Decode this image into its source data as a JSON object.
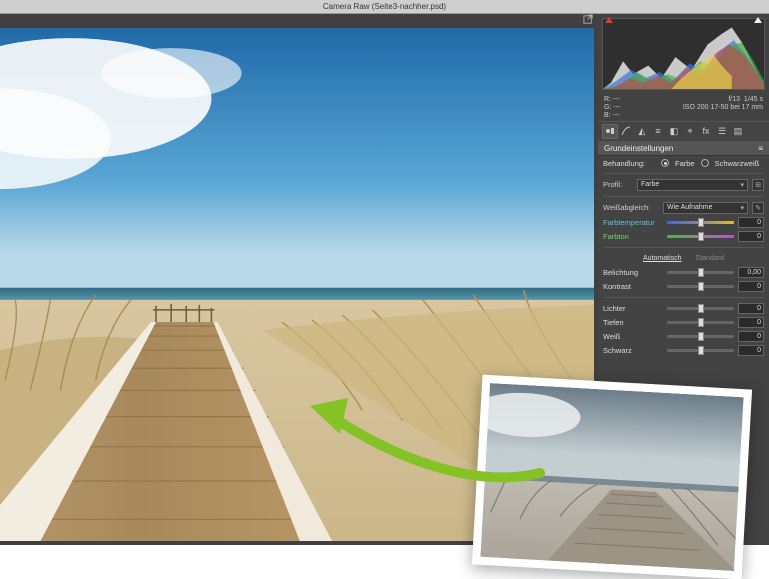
{
  "titlebar": {
    "title": "Camera Raw (Seite3-nachher.psd)"
  },
  "meta": {
    "r": "R:   ---",
    "g": "G:   ---",
    "b": "B:   ---",
    "aperture": "f/13",
    "shutter": "1/45 s",
    "iso_lens": "ISO 200   17-50 bei 17 mm"
  },
  "panel": {
    "header": "Grundeinstellungen",
    "treatment_label": "Behandlung:",
    "treatment_color": "Farbe",
    "treatment_bw": "Schwarzweiß",
    "profile_label": "Profil:",
    "profile_value": "Farbe",
    "wb_label": "Weißabgleich:",
    "wb_value": "Wie Aufnahme",
    "temp_label": "Farbtemperatur",
    "tint_label": "Farbton",
    "auto_link": "Automatisch",
    "default_link": "Standard",
    "sliders": {
      "exposure": {
        "label": "Belichtung",
        "value": "0,00"
      },
      "contrast": {
        "label": "Kontrast",
        "value": "0"
      },
      "highlights": {
        "label": "Lichter",
        "value": "0"
      },
      "shadows": {
        "label": "Tiefen",
        "value": "0"
      },
      "whites": {
        "label": "Weiß",
        "value": "0"
      },
      "blacks": {
        "label": "Schwarz",
        "value": "0"
      }
    },
    "zero": "0"
  }
}
